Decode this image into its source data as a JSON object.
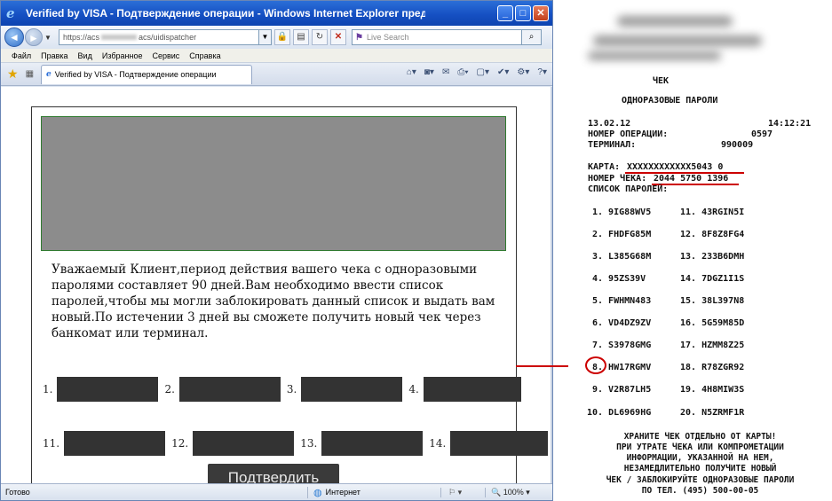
{
  "window": {
    "title": "Verified by VISA - Подтверждение операции - Windows Internet Explorer предоставлен компанией",
    "url": "https://acs",
    "url_tail": "acs/uidispatcher",
    "search_placeholder": "Live Search"
  },
  "menu": [
    "Файл",
    "Правка",
    "Вид",
    "Избранное",
    "Сервис",
    "Справка"
  ],
  "tab": {
    "label": "Verified by VISA - Подтверждение операции"
  },
  "page": {
    "message": "Уважаемый Клиент,период действия вашего чека с одноразовыми паролями составляет 90 дней.Вам необходимо ввести список паролей,чтобы мы могли заблокировать данный список и выдать вам новый.По истечении 3 дней вы сможете получить новый чек через банкомат или терминал.",
    "row1": [
      "1.",
      "2.",
      "3.",
      "4."
    ],
    "row2": [
      "11.",
      "12.",
      "13.",
      "14."
    ],
    "confirm_label": "Подтвердить"
  },
  "status": {
    "text": "Готово",
    "zone": "Интернет",
    "zoom": "100%"
  },
  "receipt": {
    "header": "ЧЕК",
    "subheader": "ОДНОРАЗОВЫЕ ПАРОЛИ",
    "date": "13.02.12",
    "time": "14:12:21",
    "op_label": "НОМЕР ОПЕРАЦИИ:",
    "op_value": "0597",
    "term_label": "ТЕРМИНАЛ:",
    "term_value": "990009",
    "card_label": "КАРТА:",
    "card_value": "XXXXXXXXXXXX5043 0",
    "check_label": "НОМЕР ЧЕКА:",
    "check_value": "2044 5750 1396",
    "list_label": "СПИСОК ПАРОЛЕЙ:",
    "passwords_left": [
      "1. 9IG88WV5",
      "2. FHDFG85M",
      "3. L385G68M",
      "4. 95ZS39V",
      "5. FWHMN483",
      "6. VD4DZ9ZV",
      "7. S3978GMG",
      "8. HW17RGMV",
      "9. V2R87LH5",
      "10. DL6969HG"
    ],
    "passwords_right": [
      "11. 43RGIN5I",
      "12. 8F8Z8FG4",
      "13. 233B6DMH",
      "14. 7DGZ1I1S",
      "15. 38L397N8",
      "16. 5G59M85D",
      "17. HZMM8Z25",
      "18. R78ZGR92",
      "19. 4H8MIW3S",
      "20. N5ZRMF1R"
    ],
    "footer": [
      "ХРАНИТЕ ЧЕК ОТДЕЛЬНО ОТ КАРТЫ!",
      "ПРИ УТРАТЕ ЧЕКА ИЛИ КОМПРОМЕТАЦИИ",
      "ИНФОРМАЦИИ, УКАЗАННОЙ НА НЕМ,",
      "НЕЗАМЕДЛИТЕЛЬНО ПОЛУЧИТЕ НОВЫЙ",
      "ЧЕК / ЗАБЛОКИРУЙТЕ ОДНОРАЗОВЫЕ ПАРОЛИ",
      "ПО ТЕЛ. (495) 500-00-05"
    ]
  },
  "colors": {
    "highlight": "#cc0000",
    "titlebar": "#1650c3",
    "field": "#333333"
  }
}
